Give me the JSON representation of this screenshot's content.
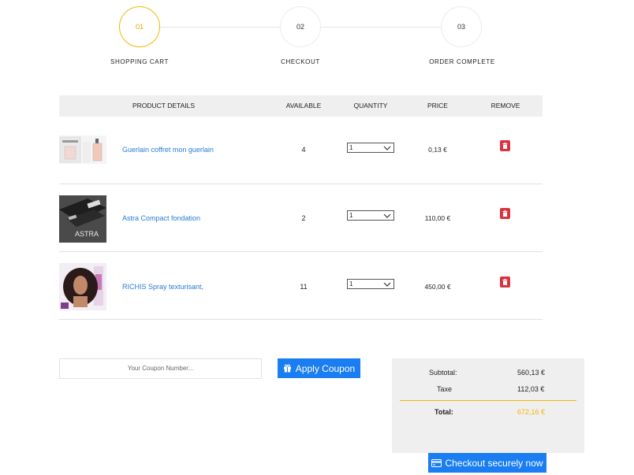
{
  "steps": [
    {
      "number": "01",
      "label": "SHOPPING CART"
    },
    {
      "number": "02",
      "label": "CHECKOUT"
    },
    {
      "number": "03",
      "label": "ORDER COMPLETE"
    }
  ],
  "table": {
    "headers": {
      "product": "PRODUCT DETAILS",
      "available": "AVAILABLE",
      "quantity": "QUANTITY",
      "price": "PRICE",
      "remove": "REMOVE"
    },
    "rows": [
      {
        "name": "Guerlain coffret mon guerlain",
        "available": "4",
        "quantity": "1",
        "price": "0,13 €"
      },
      {
        "name": "Astra Compact fondation",
        "available": "2",
        "quantity": "1",
        "price": "110,00 €"
      },
      {
        "name": "RICHIS Spray texturisant,",
        "available": "11",
        "quantity": "1",
        "price": "450,00 €"
      }
    ]
  },
  "coupon": {
    "placeholder": "Your Coupon Number...",
    "button_label": "Apply Coupon"
  },
  "totals": {
    "subtotal_label": "Subtotal:",
    "subtotal_value": "560,13 €",
    "tax_label": "Taxe",
    "tax_value": "112,03 €",
    "total_label": "Total:",
    "total_value": "672,16 €"
  },
  "checkout_button": "Checkout securely now",
  "colors": {
    "accent": "#f2b705",
    "primary": "#1a7ef2",
    "link": "#2a7bd4",
    "danger": "#d9333f"
  }
}
